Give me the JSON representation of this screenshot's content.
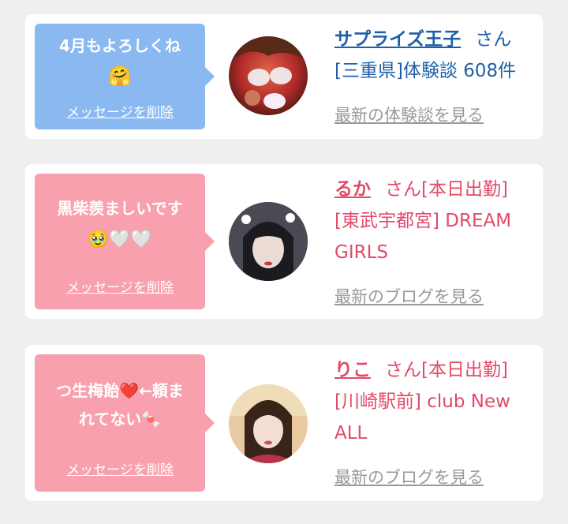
{
  "cards": [
    {
      "message_lines": [
        "4月もよろしくね",
        "🤗"
      ],
      "delete_label": "メッセージを削除",
      "name": "サプライズ王子",
      "san": "さん",
      "detail_lines": [
        "[三重県]体験談 608件"
      ],
      "latest_label": "最新の体験談を見る",
      "theme": "blue"
    },
    {
      "message_lines": [
        "黒柴羨ましいです",
        "🥹🤍🤍"
      ],
      "delete_label": "メッセージを削除",
      "name": "るか",
      "san": "さん[本日出勤]",
      "detail_lines": [
        "[東武宇都宮] DREAM",
        "GIRLS"
      ],
      "latest_label": "最新のブログを見る",
      "theme": "pink"
    },
    {
      "message_lines": [
        "つ生梅飴❤️←頼ま",
        "れてない🍬"
      ],
      "delete_label": "メッセージを削除",
      "name": "りこ",
      "san": "さん[本日出勤]",
      "detail_lines": [
        "[川崎駅前] club New",
        "ALL"
      ],
      "latest_label": "最新のブログを見る",
      "theme": "pink"
    }
  ],
  "colors": {
    "blue_bubble": "#8ab9f2",
    "pink_bubble": "#f8a0ad",
    "blue_text": "#1f5fa8",
    "pink_text": "#e24a6a",
    "background": "#efefef"
  }
}
